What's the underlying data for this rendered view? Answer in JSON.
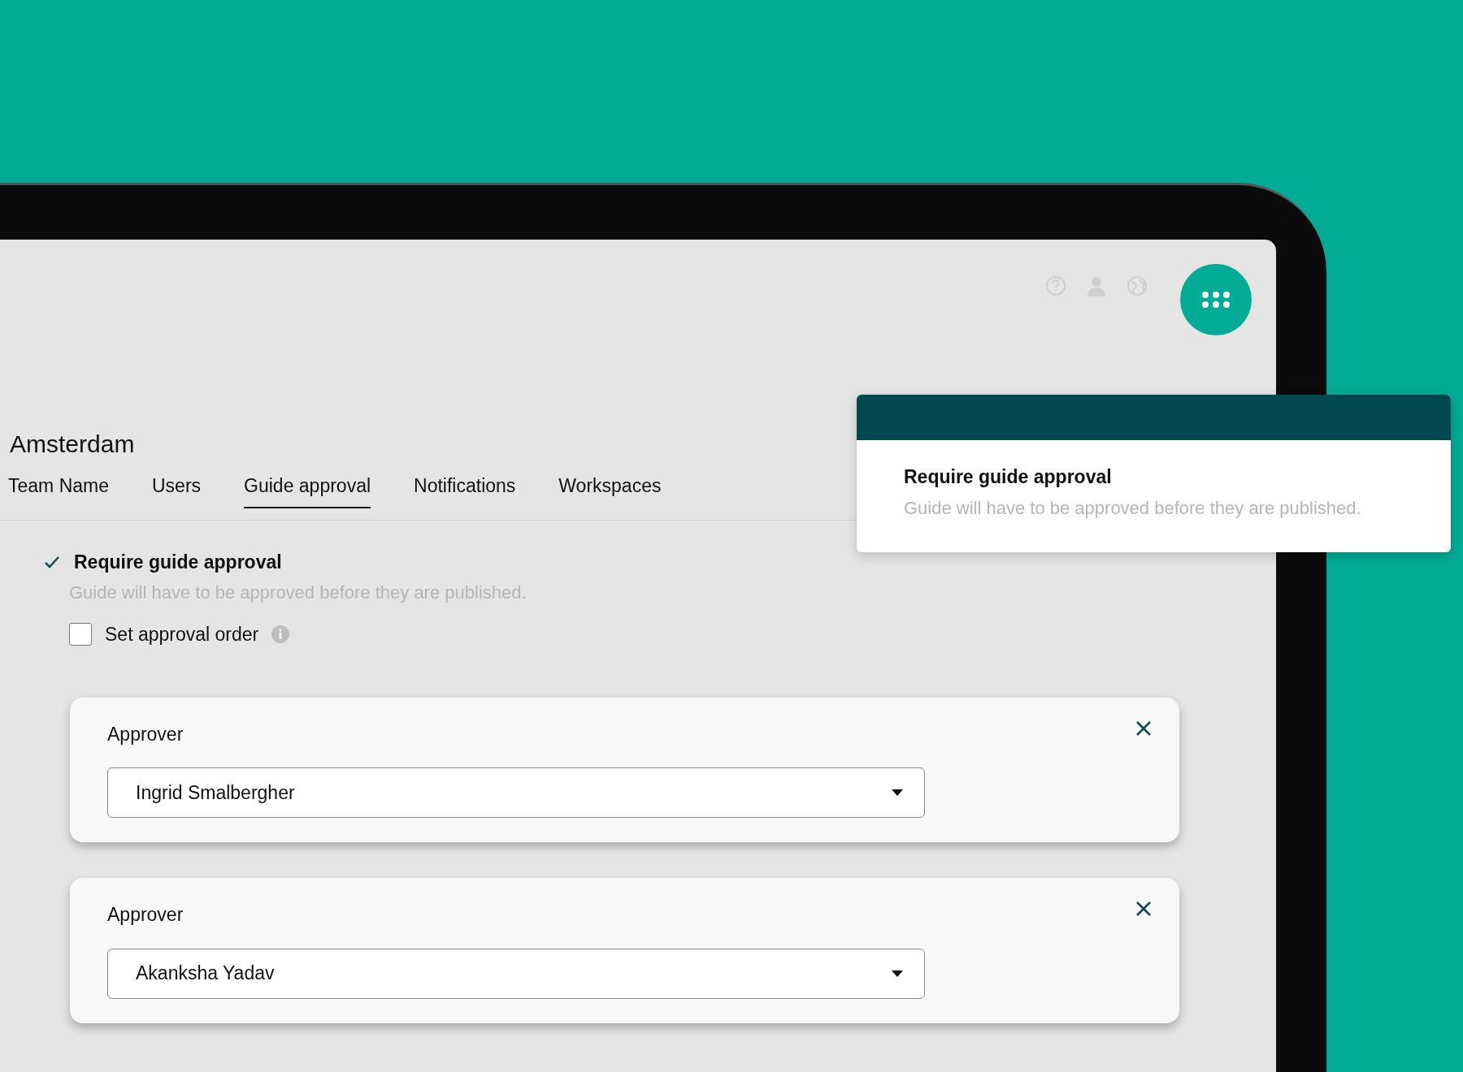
{
  "heading": "Amsterdam",
  "tabs": [
    {
      "label": "Team Name",
      "selected": false
    },
    {
      "label": "Users",
      "selected": false
    },
    {
      "label": "Guide approval",
      "selected": true
    },
    {
      "label": "Notifications",
      "selected": false
    },
    {
      "label": "Workspaces",
      "selected": false
    }
  ],
  "settings": [
    {
      "kind": "checkmark",
      "label": "Require guide approval",
      "description": "Guide will have to be approved before they are published.",
      "checked": true
    },
    {
      "kind": "checkbox",
      "label": "Set approval order",
      "checked": false
    }
  ],
  "approvers": [
    {
      "label": "Approver",
      "value": "Ingrid Smalbergher"
    },
    {
      "label": "Approver",
      "value": "Akanksha Yadav"
    }
  ],
  "popup": {
    "title": "Require guide approval",
    "description": "Guide will have to be approved before they are published."
  }
}
